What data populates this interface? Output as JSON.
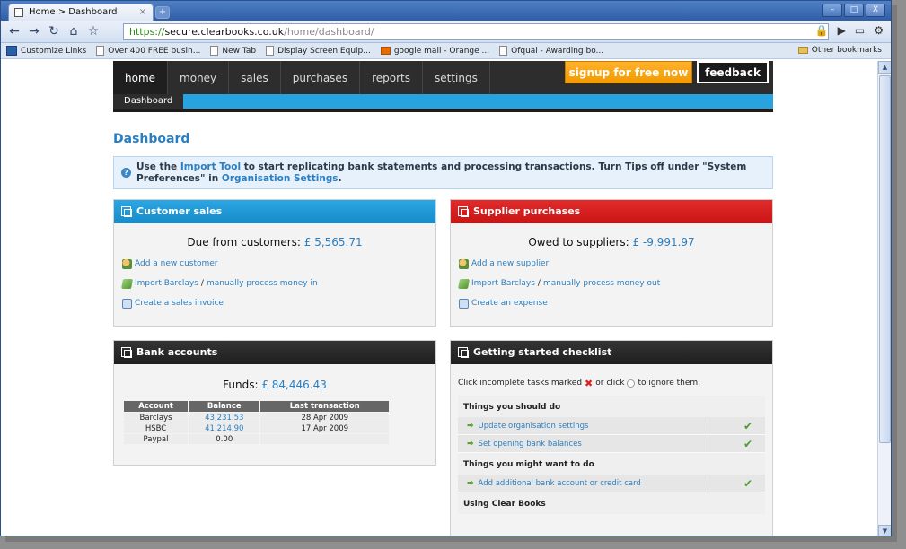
{
  "browser": {
    "tab_title": "Home > Dashboard",
    "tab_close": "×",
    "new_tab": "+",
    "url_secure": "https://",
    "url_host": "secure.clearbooks.co.uk",
    "url_path": "/home/dashboard/",
    "bookmarks": [
      "Customize Links",
      "Over 400 FREE busin...",
      "New Tab",
      "Display Screen Equip...",
      "google mail - Orange ...",
      "Ofqual - Awarding bo..."
    ],
    "other_bookmarks": "Other bookmarks"
  },
  "app": {
    "nav": [
      "home",
      "money",
      "sales",
      "purchases",
      "reports",
      "settings"
    ],
    "signup": "signup for free now",
    "feedback": "feedback",
    "subnav": "Dashboard",
    "page_title": "Dashboard",
    "tip": {
      "pre": "Use the ",
      "link1": "Import Tool",
      "mid": " to start replicating bank statements and processing transactions. Turn Tips off under \"System Preferences\" in ",
      "link2": "Organisation Settings",
      "post": "."
    },
    "customer": {
      "title": "Customer sales",
      "due_label": "Due from customers: ",
      "due_amount": "£ 5,565.71",
      "add": "Add a new customer",
      "import": "Import Barclays",
      "slash": "/",
      "manual": "manually process money in",
      "invoice": "Create a sales invoice"
    },
    "supplier": {
      "title": "Supplier purchases",
      "owed_label": "Owed to suppliers: ",
      "owed_amount": "£ -9,991.97",
      "add": "Add a new supplier",
      "import": "Import Barclays",
      "slash": "/",
      "manual": "manually process money out",
      "expense": "Create an expense"
    },
    "bank": {
      "title": "Bank accounts",
      "funds_label": "Funds: ",
      "funds_amount": "£ 84,446.43",
      "headers": [
        "Account",
        "Balance",
        "Last transaction"
      ],
      "rows": [
        {
          "account": "Barclays",
          "balance": "43,231.53",
          "last": "28 Apr 2009"
        },
        {
          "account": "HSBC",
          "balance": "41,214.90",
          "last": "17 Apr 2009"
        },
        {
          "account": "Paypal",
          "balance": "0.00",
          "last": ""
        }
      ]
    },
    "checklist": {
      "title": "Getting started checklist",
      "intro_pre": "Click incomplete tasks marked",
      "intro_mid": "or click",
      "intro_post": "to ignore them.",
      "sections": [
        {
          "title": "Things you should do",
          "tasks": [
            "Update organisation settings",
            "Set opening bank balances"
          ]
        },
        {
          "title": "Things you might want to do",
          "tasks": [
            "Add additional bank account or credit card"
          ]
        },
        {
          "title": "Using Clear Books",
          "tasks": []
        }
      ]
    }
  }
}
